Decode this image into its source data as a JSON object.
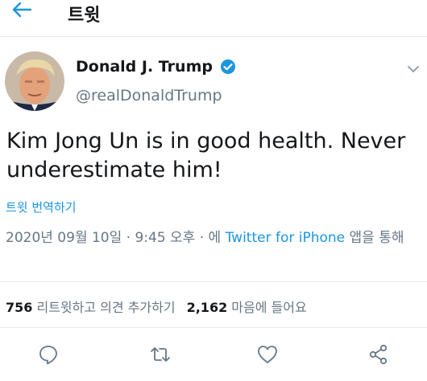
{
  "header": {
    "back_icon": "arrow-left-icon",
    "title": "트윗"
  },
  "tweet": {
    "author": {
      "name": "Donald J. Trump",
      "handle": "@realDonaldTrump",
      "verified": true
    },
    "text_line1": "Kim Jong Un is in good health. Never",
    "text_line2": "underestimate him!",
    "translate_label": "트윗 번역하기",
    "meta": {
      "datetime": "2020년 09월 10일 · 9:45 오후 · 에 ",
      "source": "Twitter for iPhone",
      "suffix": " 앱을 통해"
    },
    "stats": {
      "retweets_count": "756",
      "retweets_label": " 리트윗하고 의견 추가하기",
      "likes_count": "2,162",
      "likes_label": " 마음에 들어요"
    },
    "actions": [
      "reply-icon",
      "retweet-icon",
      "like-icon",
      "share-icon"
    ]
  },
  "colors": {
    "accent": "#1b95e0",
    "secondary_text": "#657786",
    "divider": "#e6ecf0"
  }
}
